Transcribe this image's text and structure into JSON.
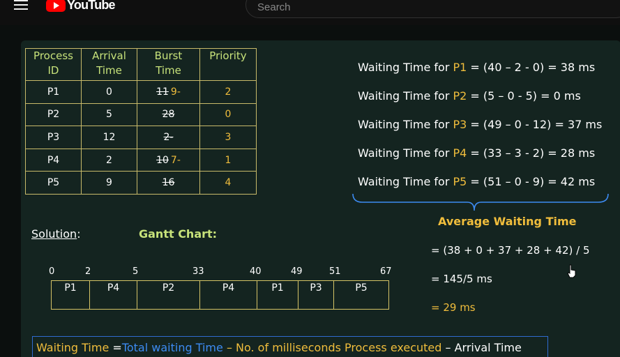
{
  "header": {
    "logo_text": "YouTube",
    "search_placeholder": "Search"
  },
  "table": {
    "headers": [
      [
        "Process",
        "ID"
      ],
      [
        "Arrival",
        "Time"
      ],
      [
        "Burst",
        "Time"
      ],
      [
        "Priority",
        ""
      ]
    ],
    "rows": [
      {
        "pid": "P1",
        "arrival": "0",
        "burst_old": "11",
        "burst_new": "9-",
        "priority": "2"
      },
      {
        "pid": "P2",
        "arrival": "5",
        "burst_old": "28",
        "burst_new": "",
        "priority": "0"
      },
      {
        "pid": "P3",
        "arrival": "12",
        "burst_old": "2-",
        "burst_new": "",
        "priority": "3"
      },
      {
        "pid": "P4",
        "arrival": "2",
        "burst_old": "10",
        "burst_new": "7-",
        "priority": "1"
      },
      {
        "pid": "P5",
        "arrival": "9",
        "burst_old": "16",
        "burst_new": "",
        "priority": "4"
      }
    ]
  },
  "waiting": [
    {
      "prefix": "Waiting Time for ",
      "pid": "P1",
      "formula": "=   (40 – 2 - 0)  = 38 ms"
    },
    {
      "prefix": "Waiting Time for ",
      "pid": "P2",
      "formula": "=   (5 – 0 - 5)    =  0 ms"
    },
    {
      "prefix": "Waiting Time for ",
      "pid": "P3",
      "formula": "=   (49 – 0 - 12) = 37 ms"
    },
    {
      "prefix": "Waiting Time for ",
      "pid": "P4",
      "formula": "=   (33 – 3 - 2) =  28 ms"
    },
    {
      "prefix": "Waiting Time for ",
      "pid": "P5",
      "formula": "=   (51 – 0 - 9) =  42 ms"
    }
  ],
  "average": {
    "title": "Average Waiting Time",
    "line1": "= (38 + 0 + 37 + 28 + 42) / 5",
    "line2": "= 145/5 ms",
    "line3": "= 29 ms"
  },
  "solution_label": "Solution",
  "solution_colon": ":",
  "gantt": {
    "title": "Gantt Chart:",
    "ticks": [
      "0",
      "2",
      "5",
      "33",
      "40",
      "49",
      "51",
      "67"
    ],
    "cells": [
      "P1",
      "P4",
      "P2",
      "P4",
      "P1",
      "P3",
      "P5"
    ]
  },
  "formula": {
    "part1": "Waiting Time",
    "part2": " =",
    "part3": "Total waiting Time",
    "part4": " – No. of milliseconds Process executed",
    "part5": " – Arrival Time"
  },
  "colors": {
    "header_green": "#c7e27a",
    "highlight_orange": "#f0bd3c",
    "accent_blue": "#3d8bf2",
    "box_blue": "#2f6bd1",
    "border_gold": "#c9bb6a"
  }
}
